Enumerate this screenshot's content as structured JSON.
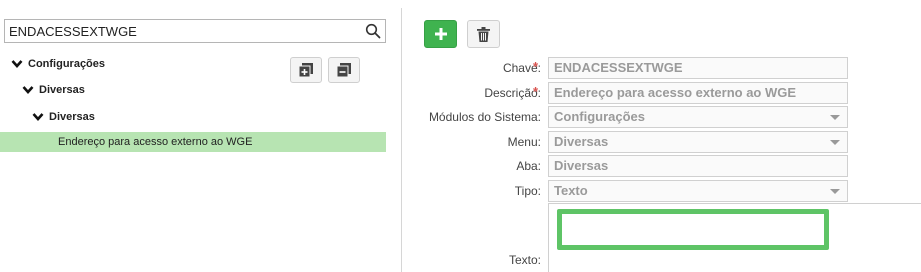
{
  "search": {
    "value": "ENDACESSEXTWGE",
    "icon": "search-icon"
  },
  "tree": {
    "nodes": [
      "Configurações",
      "Diversas",
      "Diversas"
    ],
    "selected": "Endereço para acesso externo ao WGE",
    "buttons": [
      "expand-all-icon",
      "collapse-all-icon"
    ]
  },
  "toolbar": {
    "add_icon": "plus-icon",
    "delete_icon": "trash-icon",
    "add_color": "#3fb34f"
  },
  "form": {
    "chave": {
      "label": "Chave:",
      "value": "ENDACESSEXTWGE",
      "required": "*"
    },
    "descricao": {
      "label": "Descrição:",
      "value": "Endereço para acesso externo ao WGE",
      "required": "*"
    },
    "modulos": {
      "label": "Módulos do Sistema:",
      "value": "Configurações"
    },
    "menu": {
      "label": "Menu:",
      "value": "Diversas"
    },
    "aba": {
      "label": "Aba:",
      "value": "Diversas"
    },
    "tipo": {
      "label": "Tipo:",
      "value": "Texto"
    },
    "texto": {
      "label": "Texto:",
      "value": ""
    }
  },
  "colors": {
    "selected_row": "#b7e4b2",
    "focus_border": "#5ec466",
    "required": "#d9534f"
  }
}
